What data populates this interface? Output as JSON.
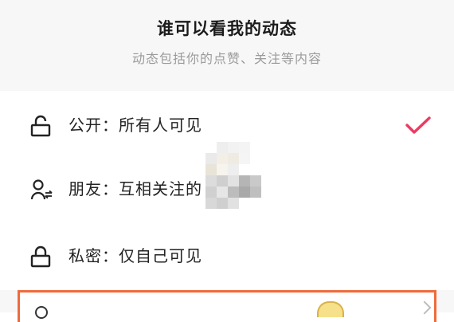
{
  "header": {
    "title": "谁可以看我的动态",
    "subtitle": "动态包括你的点赞、关注等内容"
  },
  "options": [
    {
      "icon": "unlock-icon",
      "label": "公开：所有人可见",
      "selected": true
    },
    {
      "icon": "mutual-friends-icon",
      "label": "朋友：互相关注的"
    },
    {
      "icon": "lock-icon",
      "label": "私密：仅自己可见"
    }
  ],
  "colors": {
    "accent": "#ee3a5f",
    "highlight_border": "#ef6b3c"
  }
}
